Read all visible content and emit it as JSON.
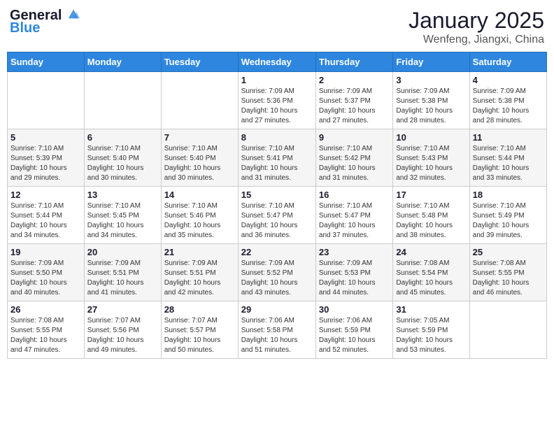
{
  "header": {
    "logo_line1": "General",
    "logo_line2": "Blue",
    "month_title": "January 2025",
    "location": "Wenfeng, Jiangxi, China"
  },
  "weekdays": [
    "Sunday",
    "Monday",
    "Tuesday",
    "Wednesday",
    "Thursday",
    "Friday",
    "Saturday"
  ],
  "weeks": [
    [
      {
        "day": "",
        "content": ""
      },
      {
        "day": "",
        "content": ""
      },
      {
        "day": "",
        "content": ""
      },
      {
        "day": "1",
        "content": "Sunrise: 7:09 AM\nSunset: 5:36 PM\nDaylight: 10 hours\nand 27 minutes."
      },
      {
        "day": "2",
        "content": "Sunrise: 7:09 AM\nSunset: 5:37 PM\nDaylight: 10 hours\nand 27 minutes."
      },
      {
        "day": "3",
        "content": "Sunrise: 7:09 AM\nSunset: 5:38 PM\nDaylight: 10 hours\nand 28 minutes."
      },
      {
        "day": "4",
        "content": "Sunrise: 7:09 AM\nSunset: 5:38 PM\nDaylight: 10 hours\nand 28 minutes."
      }
    ],
    [
      {
        "day": "5",
        "content": "Sunrise: 7:10 AM\nSunset: 5:39 PM\nDaylight: 10 hours\nand 29 minutes."
      },
      {
        "day": "6",
        "content": "Sunrise: 7:10 AM\nSunset: 5:40 PM\nDaylight: 10 hours\nand 30 minutes."
      },
      {
        "day": "7",
        "content": "Sunrise: 7:10 AM\nSunset: 5:40 PM\nDaylight: 10 hours\nand 30 minutes."
      },
      {
        "day": "8",
        "content": "Sunrise: 7:10 AM\nSunset: 5:41 PM\nDaylight: 10 hours\nand 31 minutes."
      },
      {
        "day": "9",
        "content": "Sunrise: 7:10 AM\nSunset: 5:42 PM\nDaylight: 10 hours\nand 31 minutes."
      },
      {
        "day": "10",
        "content": "Sunrise: 7:10 AM\nSunset: 5:43 PM\nDaylight: 10 hours\nand 32 minutes."
      },
      {
        "day": "11",
        "content": "Sunrise: 7:10 AM\nSunset: 5:44 PM\nDaylight: 10 hours\nand 33 minutes."
      }
    ],
    [
      {
        "day": "12",
        "content": "Sunrise: 7:10 AM\nSunset: 5:44 PM\nDaylight: 10 hours\nand 34 minutes."
      },
      {
        "day": "13",
        "content": "Sunrise: 7:10 AM\nSunset: 5:45 PM\nDaylight: 10 hours\nand 34 minutes."
      },
      {
        "day": "14",
        "content": "Sunrise: 7:10 AM\nSunset: 5:46 PM\nDaylight: 10 hours\nand 35 minutes."
      },
      {
        "day": "15",
        "content": "Sunrise: 7:10 AM\nSunset: 5:47 PM\nDaylight: 10 hours\nand 36 minutes."
      },
      {
        "day": "16",
        "content": "Sunrise: 7:10 AM\nSunset: 5:47 PM\nDaylight: 10 hours\nand 37 minutes."
      },
      {
        "day": "17",
        "content": "Sunrise: 7:10 AM\nSunset: 5:48 PM\nDaylight: 10 hours\nand 38 minutes."
      },
      {
        "day": "18",
        "content": "Sunrise: 7:10 AM\nSunset: 5:49 PM\nDaylight: 10 hours\nand 39 minutes."
      }
    ],
    [
      {
        "day": "19",
        "content": "Sunrise: 7:09 AM\nSunset: 5:50 PM\nDaylight: 10 hours\nand 40 minutes."
      },
      {
        "day": "20",
        "content": "Sunrise: 7:09 AM\nSunset: 5:51 PM\nDaylight: 10 hours\nand 41 minutes."
      },
      {
        "day": "21",
        "content": "Sunrise: 7:09 AM\nSunset: 5:51 PM\nDaylight: 10 hours\nand 42 minutes."
      },
      {
        "day": "22",
        "content": "Sunrise: 7:09 AM\nSunset: 5:52 PM\nDaylight: 10 hours\nand 43 minutes."
      },
      {
        "day": "23",
        "content": "Sunrise: 7:09 AM\nSunset: 5:53 PM\nDaylight: 10 hours\nand 44 minutes."
      },
      {
        "day": "24",
        "content": "Sunrise: 7:08 AM\nSunset: 5:54 PM\nDaylight: 10 hours\nand 45 minutes."
      },
      {
        "day": "25",
        "content": "Sunrise: 7:08 AM\nSunset: 5:55 PM\nDaylight: 10 hours\nand 46 minutes."
      }
    ],
    [
      {
        "day": "26",
        "content": "Sunrise: 7:08 AM\nSunset: 5:55 PM\nDaylight: 10 hours\nand 47 minutes."
      },
      {
        "day": "27",
        "content": "Sunrise: 7:07 AM\nSunset: 5:56 PM\nDaylight: 10 hours\nand 49 minutes."
      },
      {
        "day": "28",
        "content": "Sunrise: 7:07 AM\nSunset: 5:57 PM\nDaylight: 10 hours\nand 50 minutes."
      },
      {
        "day": "29",
        "content": "Sunrise: 7:06 AM\nSunset: 5:58 PM\nDaylight: 10 hours\nand 51 minutes."
      },
      {
        "day": "30",
        "content": "Sunrise: 7:06 AM\nSunset: 5:59 PM\nDaylight: 10 hours\nand 52 minutes."
      },
      {
        "day": "31",
        "content": "Sunrise: 7:05 AM\nSunset: 5:59 PM\nDaylight: 10 hours\nand 53 minutes."
      },
      {
        "day": "",
        "content": ""
      }
    ]
  ]
}
